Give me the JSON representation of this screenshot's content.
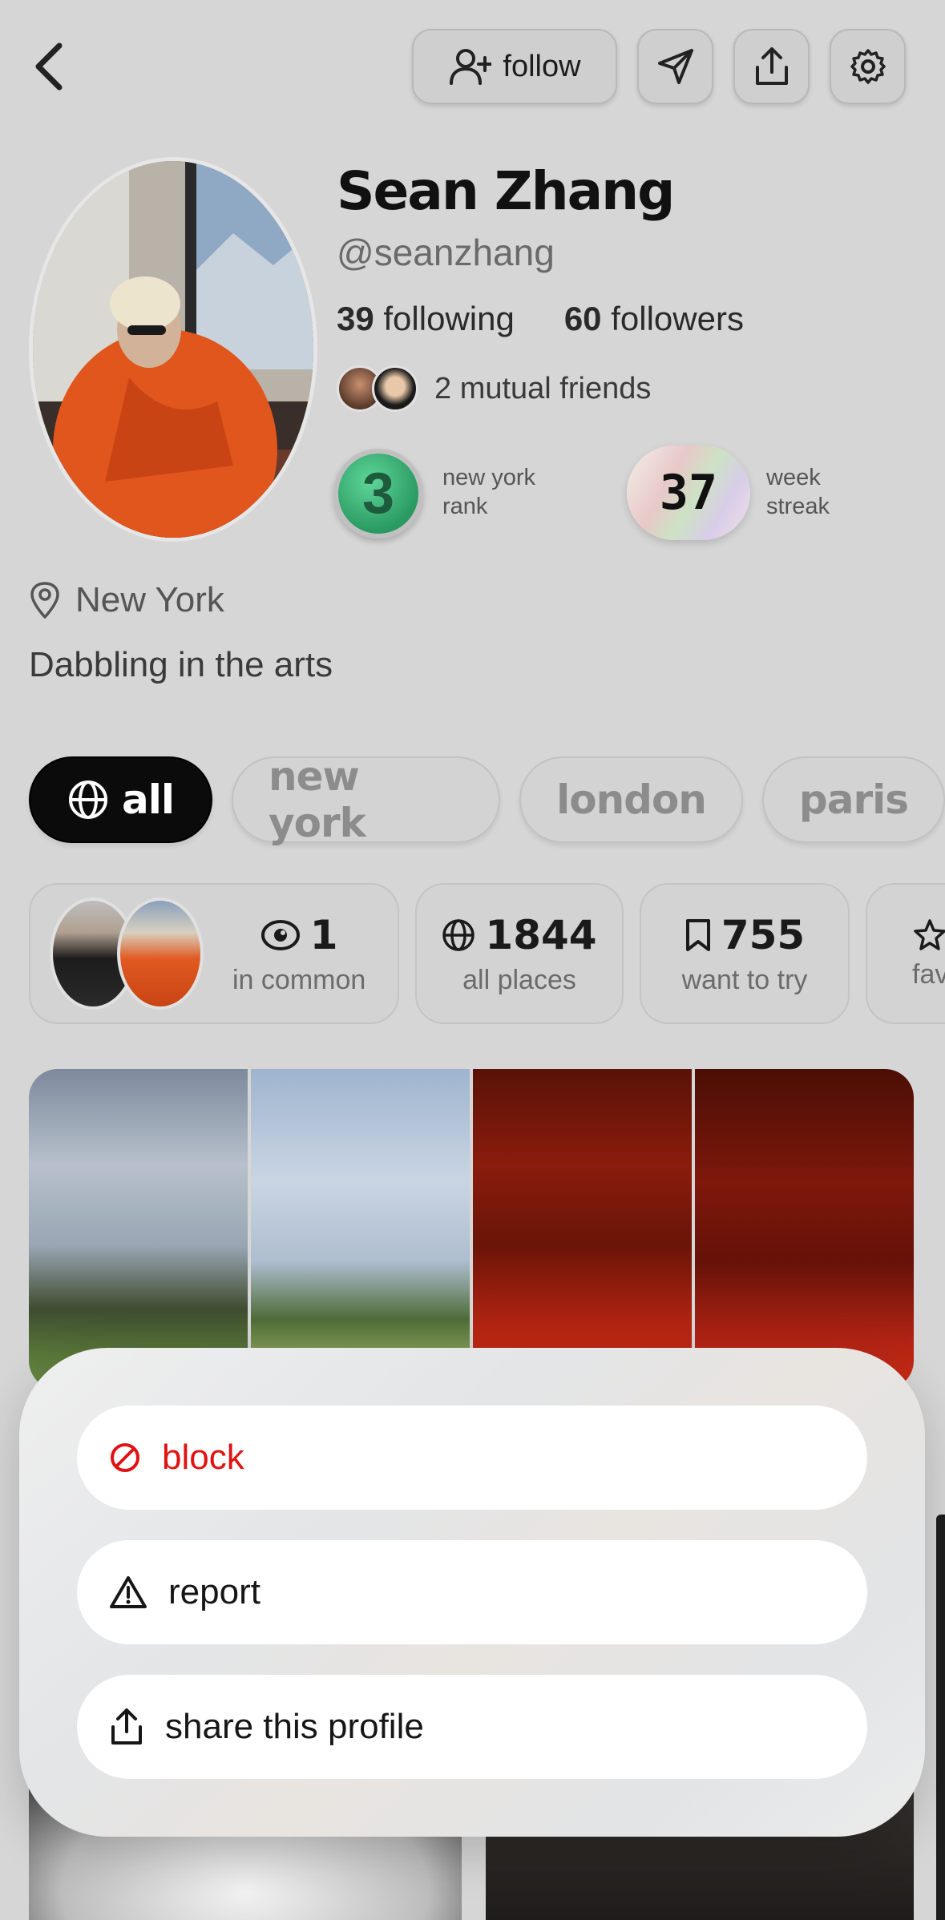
{
  "header": {
    "follow_label": "follow"
  },
  "profile": {
    "name": "Sean Zhang",
    "handle": "@seanzhang",
    "following_count": "39",
    "following_label": "following",
    "followers_count": "60",
    "followers_label": "followers",
    "mutual_friends": "2 mutual friends",
    "rank_value": "3",
    "rank_label_line1": "new york",
    "rank_label_line2": "rank",
    "streak_value": "37",
    "streak_label_line1": "week",
    "streak_label_line2": "streak",
    "location": "New York",
    "bio": "Dabbling in the arts"
  },
  "filters": {
    "all": "all",
    "new_york": "new york",
    "london": "london",
    "paris": "paris"
  },
  "stats": {
    "common_count": "1",
    "common_label": "in common",
    "places_count": "1844",
    "places_label": "all places",
    "want_count": "755",
    "want_label": "want to try",
    "fav_label": "fav"
  },
  "sheet": {
    "block_label": "block",
    "report_label": "report",
    "share_label": "share this profile"
  },
  "colors": {
    "danger": "#e01212",
    "chip_active_bg": "#0b0b0b",
    "rank_green": "#2a9a62"
  },
  "icons": [
    "chevron-left-icon",
    "user-plus-icon",
    "send-icon",
    "share-icon",
    "gear-icon",
    "map-pin-icon",
    "globe-icon",
    "eye-icon",
    "bookmark-icon",
    "star-icon",
    "block-icon",
    "warning-icon"
  ]
}
